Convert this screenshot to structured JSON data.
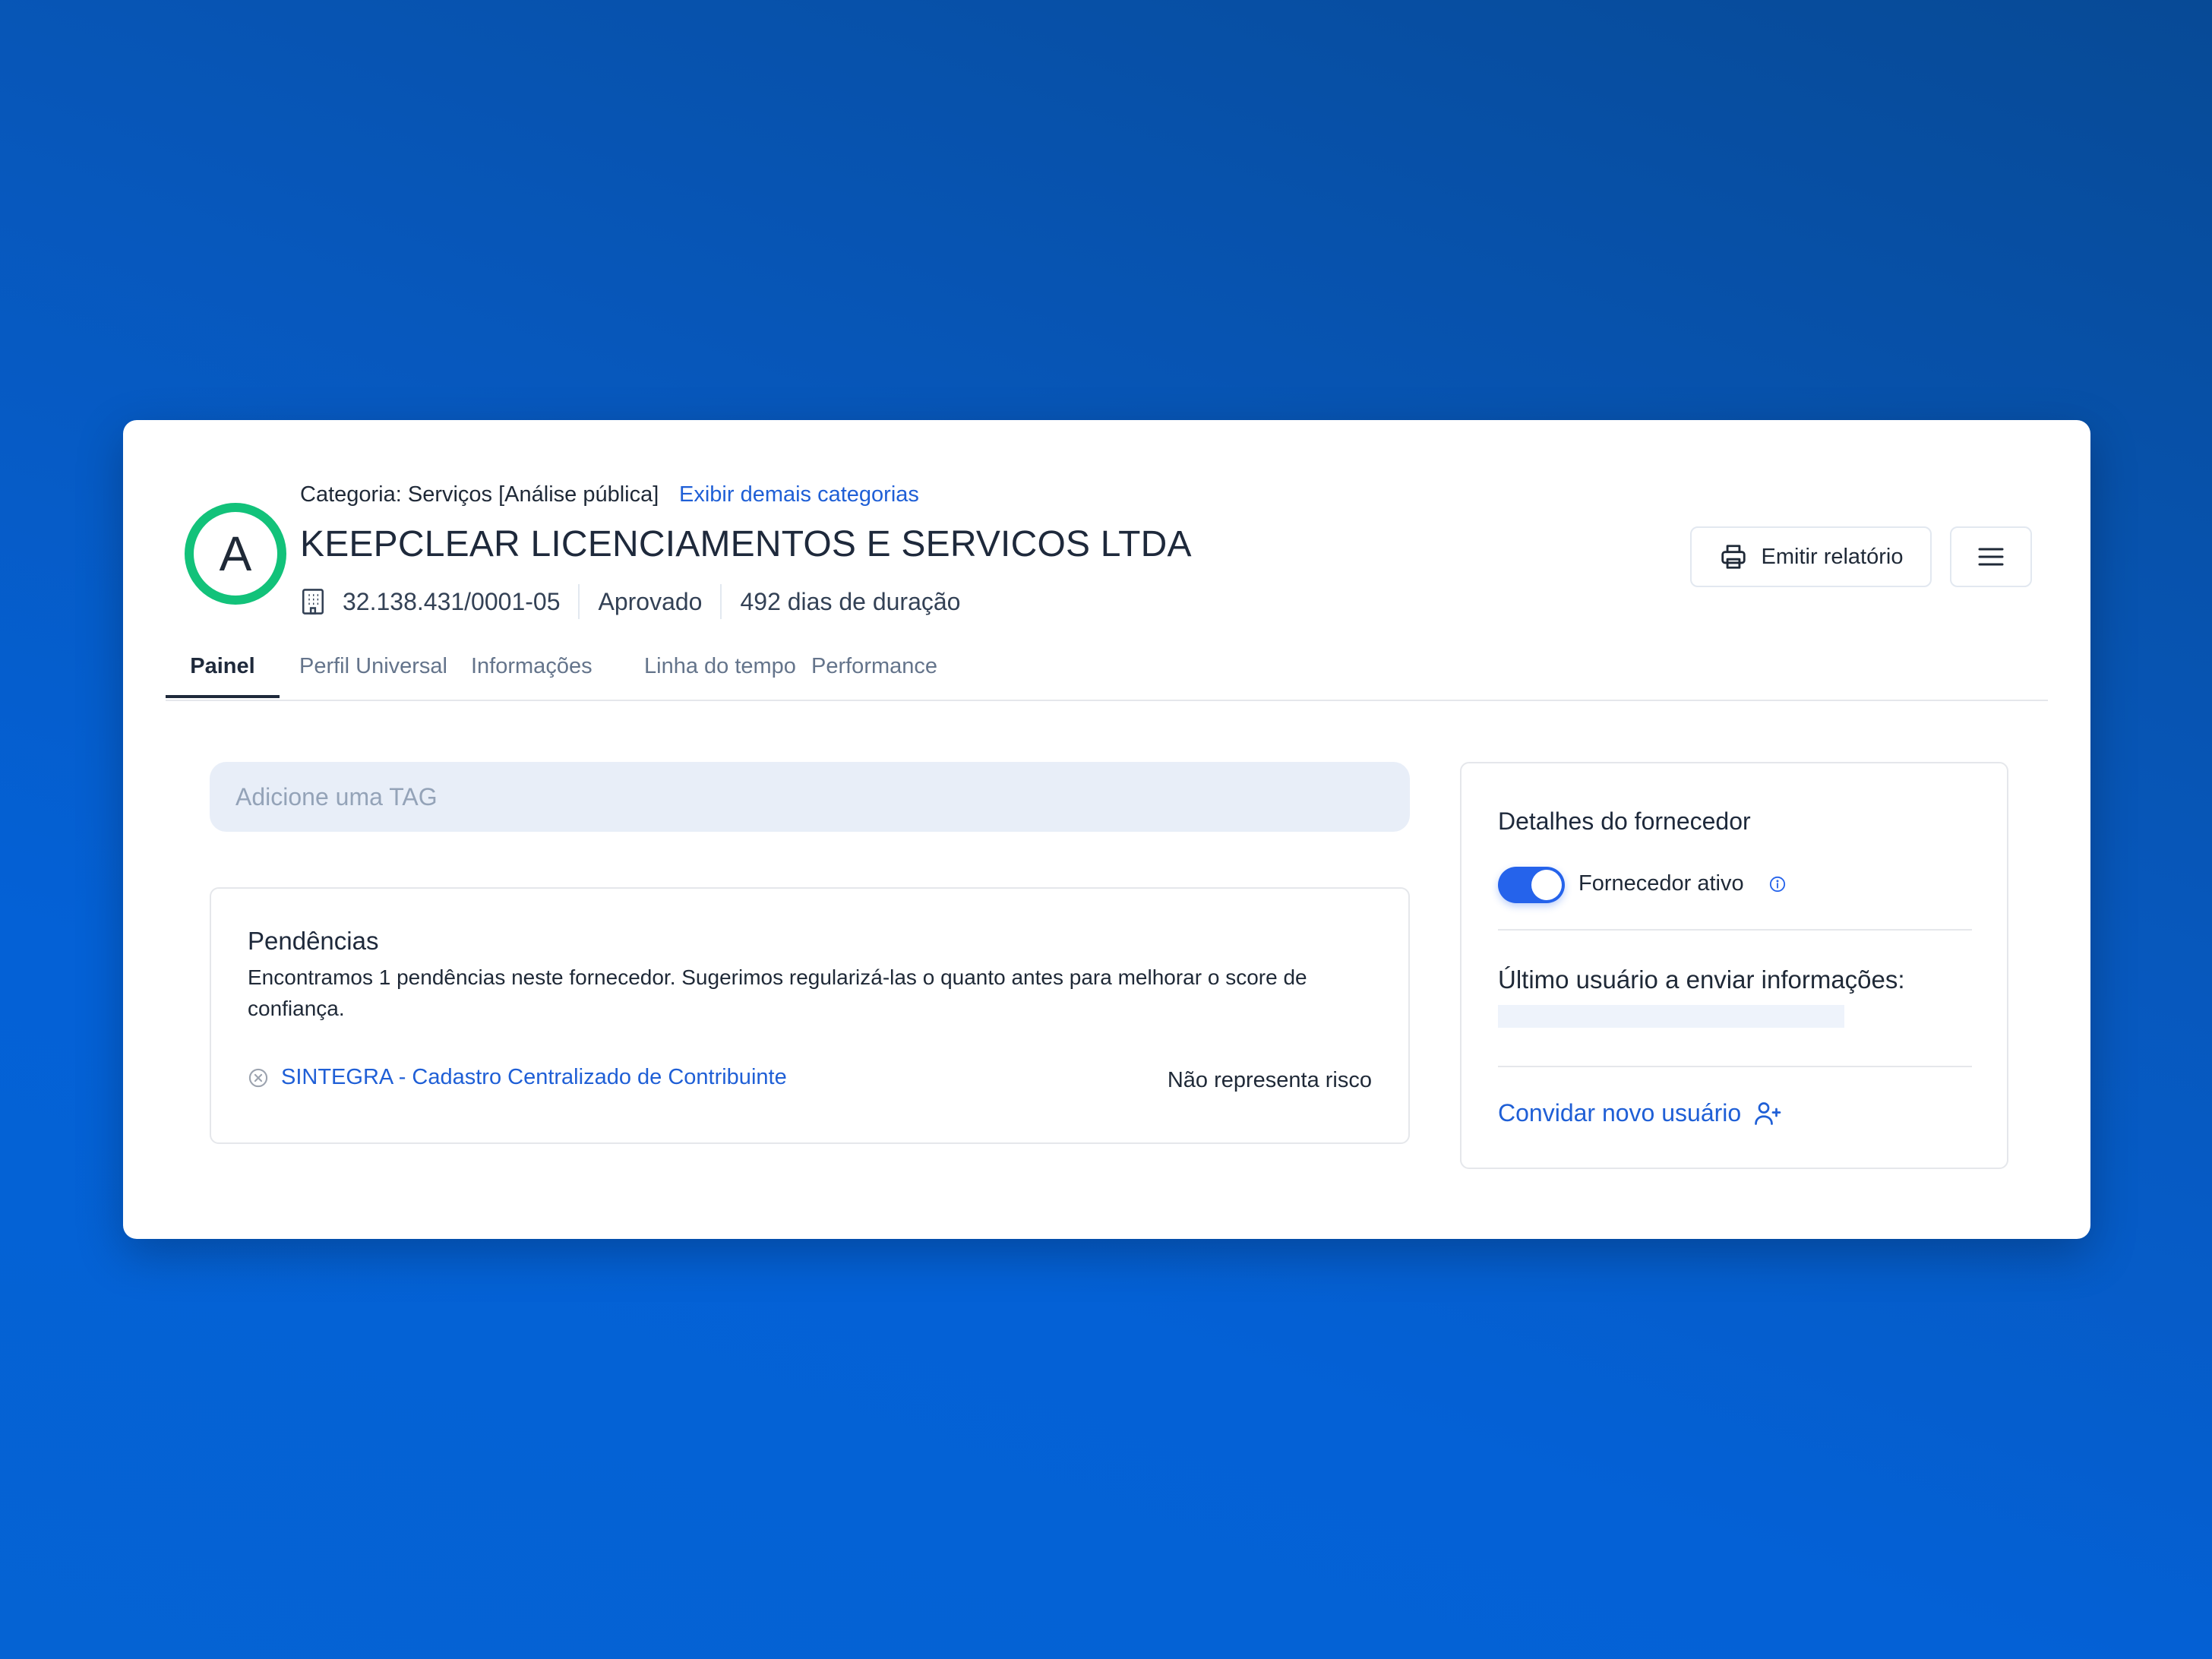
{
  "header": {
    "avatar_letter": "A",
    "category_text": "Categoria: Serviços [Análise pública]",
    "category_link": "Exibir demais categorias",
    "company_name": "KEEPCLEAR LICENCIAMENTOS E SERVICOS LTDA",
    "cnpj": "32.138.431/0001-05",
    "status": "Aprovado",
    "duration": "492 dias de duração",
    "report_button": "Emitir relatório",
    "icons": {
      "building": "building-icon",
      "printer": "printer-icon",
      "menu": "hamburger-menu-icon"
    }
  },
  "tabs": [
    {
      "label": "Painel",
      "active": true
    },
    {
      "label": "Perfil Universal",
      "active": false
    },
    {
      "label": "Informações",
      "active": false
    },
    {
      "label": "Linha do tempo",
      "active": false
    },
    {
      "label": "Performance",
      "active": false
    }
  ],
  "tag_input": {
    "placeholder": "Adicione uma TAG",
    "value": ""
  },
  "pendencias": {
    "title": "Pendências",
    "description": "Encontramos 1 pendências neste fornecedor. Sugerimos regularizá-las o quanto antes para melhorar o score de confiança.",
    "items": [
      {
        "label": "SINTEGRA - Cadastro Centralizado de Contribuinte",
        "risk": "Não representa risco",
        "icon": "x-circle-icon"
      }
    ]
  },
  "supplier_details": {
    "title": "Detalhes do fornecedor",
    "active_toggle_label": "Fornecedor ativo",
    "active": true,
    "last_user_label": "Último usuário a enviar informações:",
    "invite_label": "Convidar novo usuário",
    "invite_icon": "user-plus-icon"
  },
  "colors": {
    "accent": "#1f5fd6",
    "avatar_ring": "#12c27a",
    "toggle": "#2563eb",
    "background": "#0563d3"
  }
}
